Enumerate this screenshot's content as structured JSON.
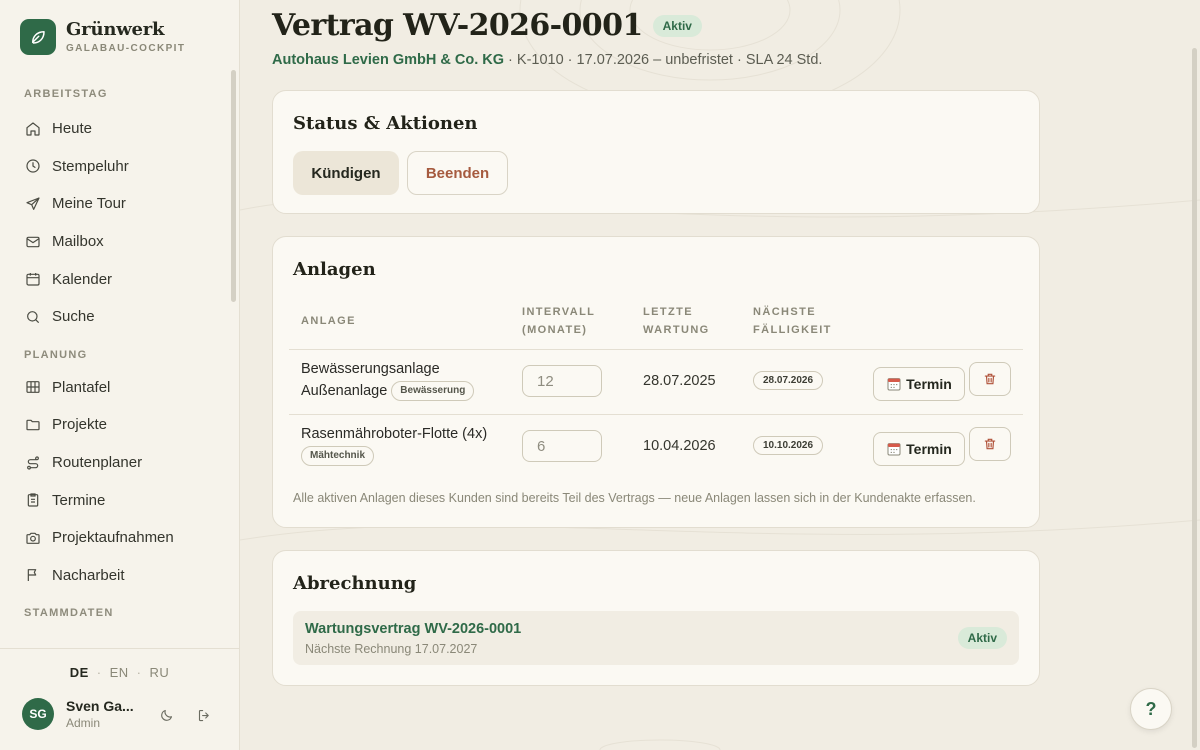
{
  "brand": {
    "name": "Grünwerk",
    "subtitle": "GALABAU-COCKPIT"
  },
  "nav": {
    "sections": [
      {
        "label": "ARBEITSTAG",
        "items": [
          {
            "label": "Heute",
            "icon": "home-icon"
          },
          {
            "label": "Stempeluhr",
            "icon": "clock-icon"
          },
          {
            "label": "Meine Tour",
            "icon": "send-icon"
          },
          {
            "label": "Mailbox",
            "icon": "mail-icon"
          },
          {
            "label": "Kalender",
            "icon": "calendar-icon"
          },
          {
            "label": "Suche",
            "icon": "search-icon"
          }
        ]
      },
      {
        "label": "PLANUNG",
        "items": [
          {
            "label": "Plantafel",
            "icon": "board-icon"
          },
          {
            "label": "Projekte",
            "icon": "folder-icon"
          },
          {
            "label": "Routenplaner",
            "icon": "route-icon"
          },
          {
            "label": "Termine",
            "icon": "clipboard-icon"
          },
          {
            "label": "Projektaufnahmen",
            "icon": "camera-icon"
          },
          {
            "label": "Nacharbeit",
            "icon": "flag-icon"
          }
        ]
      },
      {
        "label": "STAMMDATEN",
        "items": []
      }
    ]
  },
  "languages": {
    "de": "DE",
    "en": "EN",
    "ru": "RU",
    "active": "DE"
  },
  "user": {
    "initials": "SG",
    "name": "Sven Ga...",
    "role": "Admin"
  },
  "page": {
    "title": "Vertrag WV-2026-0001",
    "status": "Aktiv",
    "customer": "Autohaus Levien GmbH & Co. KG",
    "meta": " · K-1010 · 17.07.2026 – unbefristet · SLA 24 Std."
  },
  "status_card": {
    "title": "Status & Aktionen",
    "cancel_label": "Kündigen",
    "end_label": "Beenden"
  },
  "assets": {
    "title": "Anlagen",
    "headers": {
      "asset": "ANLAGE",
      "interval_1": "INTERVALL",
      "interval_2": "(MONATE)",
      "last_1": "LETZTE",
      "last_2": "WARTUNG",
      "next_1": "NÄCHSTE",
      "next_2": "FÄLLIGKEIT"
    },
    "rows": [
      {
        "name_1": "Bewässerungsanlage",
        "name_2": "Außenanlage",
        "tag": "Bewässerung",
        "interval": "12",
        "last": "28.07.2025",
        "next": "28.07.2026",
        "action": "Termin"
      },
      {
        "name_1": "Rasenmähroboter-Flotte (4x)",
        "tag": "Mähtechnik",
        "interval": "6",
        "last": "10.04.2026",
        "next": "10.10.2026",
        "action": "Termin"
      }
    ],
    "note": "Alle aktiven Anlagen dieses Kunden sind bereits Teil des Vertrags — neue Anlagen lassen sich in der Kundenakte erfassen."
  },
  "billing": {
    "title": "Abrechnung",
    "item_title": "Wartungsvertrag WV-2026-0001",
    "item_sub": "Nächste Rechnung 17.07.2027",
    "item_status": "Aktiv"
  },
  "help": {
    "label": "?"
  },
  "colors": {
    "accent": "#2f6a48",
    "danger": "#a65b3f",
    "background": "#f1ede3",
    "card": "#fbf9f3"
  }
}
